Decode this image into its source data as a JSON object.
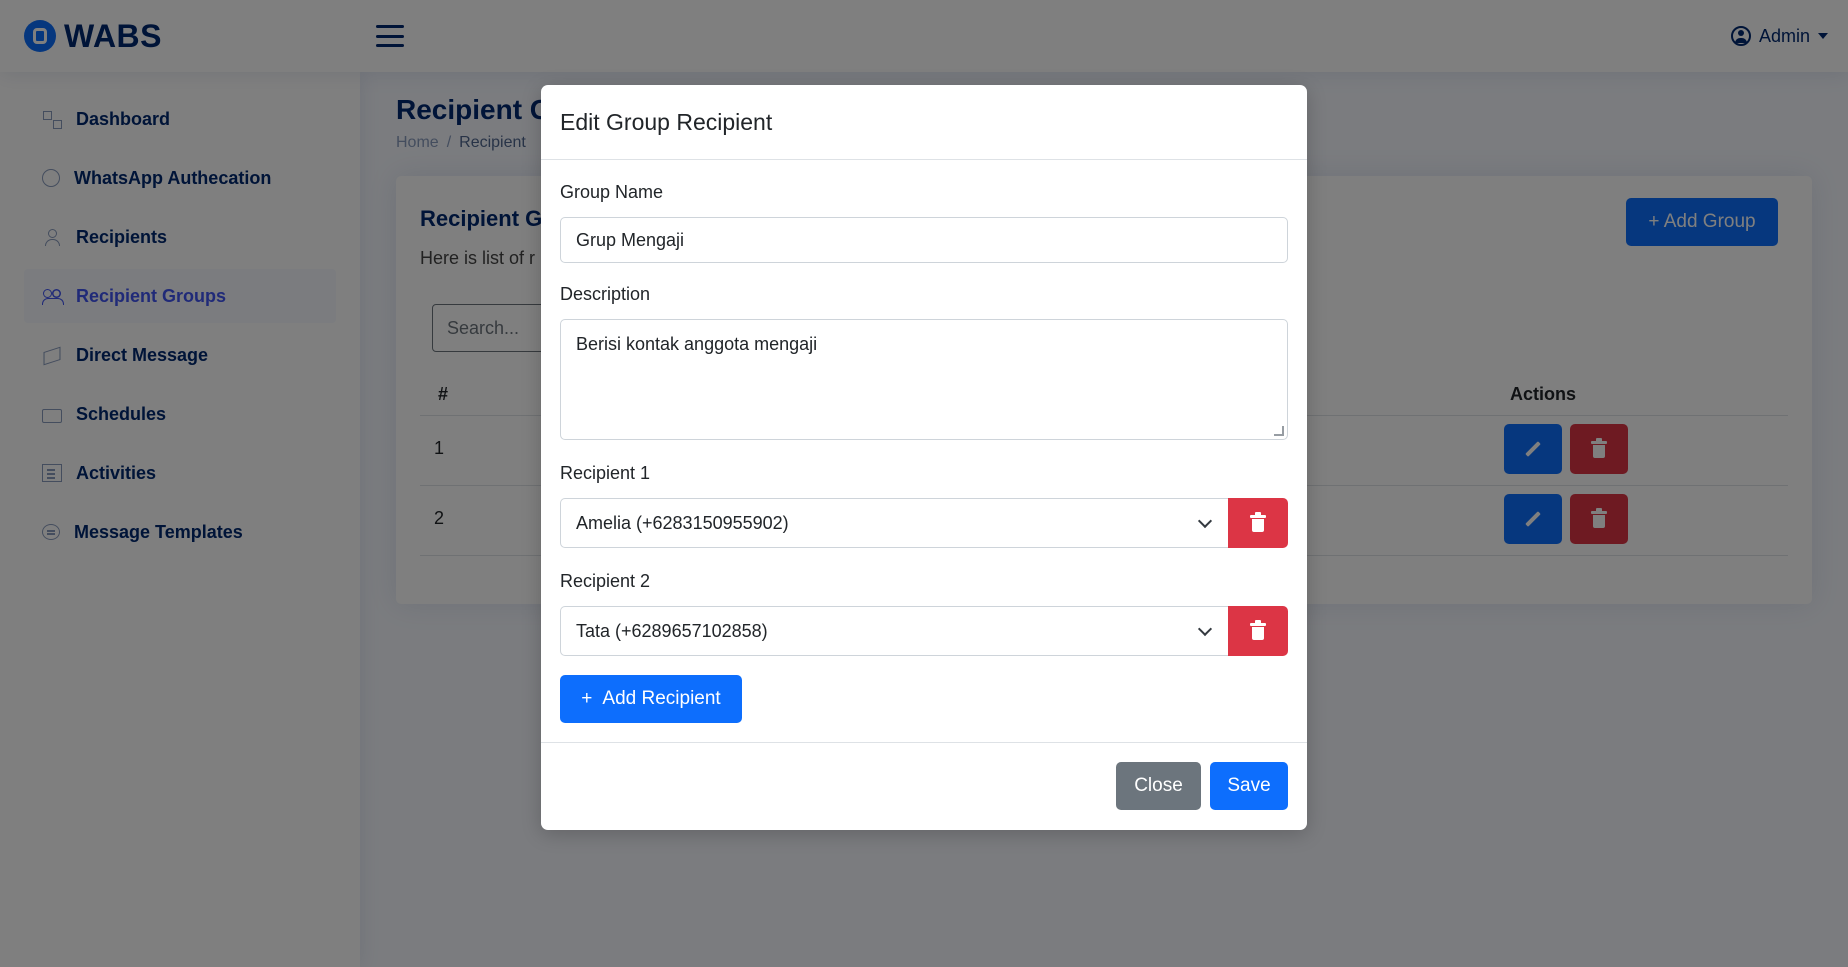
{
  "header": {
    "logo": "WABS",
    "profile_name": "Admin"
  },
  "sidebar": {
    "items": [
      {
        "label": "Dashboard",
        "icon": "grid-icon"
      },
      {
        "label": "WhatsApp Authecation",
        "icon": "whatsapp-icon"
      },
      {
        "label": "Recipients",
        "icon": "person-icon"
      },
      {
        "label": "Recipient Groups",
        "icon": "people-icon",
        "active": true
      },
      {
        "label": "Direct Message",
        "icon": "send-icon"
      },
      {
        "label": "Schedules",
        "icon": "mail-schedule-icon"
      },
      {
        "label": "Activities",
        "icon": "list-icon"
      },
      {
        "label": "Message Templates",
        "icon": "chat-bubble-icon"
      }
    ]
  },
  "main": {
    "page_title": "Recipient G",
    "breadcrumb": {
      "home": "Home",
      "sep": "/",
      "current": "Recipient"
    },
    "card_title": "Recipient G",
    "card_sub": "Here is list of r",
    "add_group_label": "+ Add Group",
    "search_placeholder": "Search...",
    "table": {
      "col_num": "#",
      "col_actions": "Actions",
      "rows": [
        {
          "num": "1"
        },
        {
          "num": "2"
        }
      ]
    }
  },
  "modal": {
    "title": "Edit Group Recipient",
    "group_name_label": "Group Name",
    "group_name_value": "Grup Mengaji",
    "description_label": "Description",
    "description_value": "Berisi kontak anggota mengaji",
    "recipient1_label": "Recipient 1",
    "recipient1_value": "Amelia (+6283150955902)",
    "recipient2_label": "Recipient 2",
    "recipient2_value": "Tata (+6289657102858)",
    "add_recipient_label": "Add Recipient",
    "add_recipient_icon": "+",
    "close_label": "Close",
    "save_label": "Save"
  },
  "colors": {
    "primary": "#0d6efd",
    "danger": "#dc3545",
    "secondary": "#6c757d",
    "brand_text": "#012970"
  }
}
